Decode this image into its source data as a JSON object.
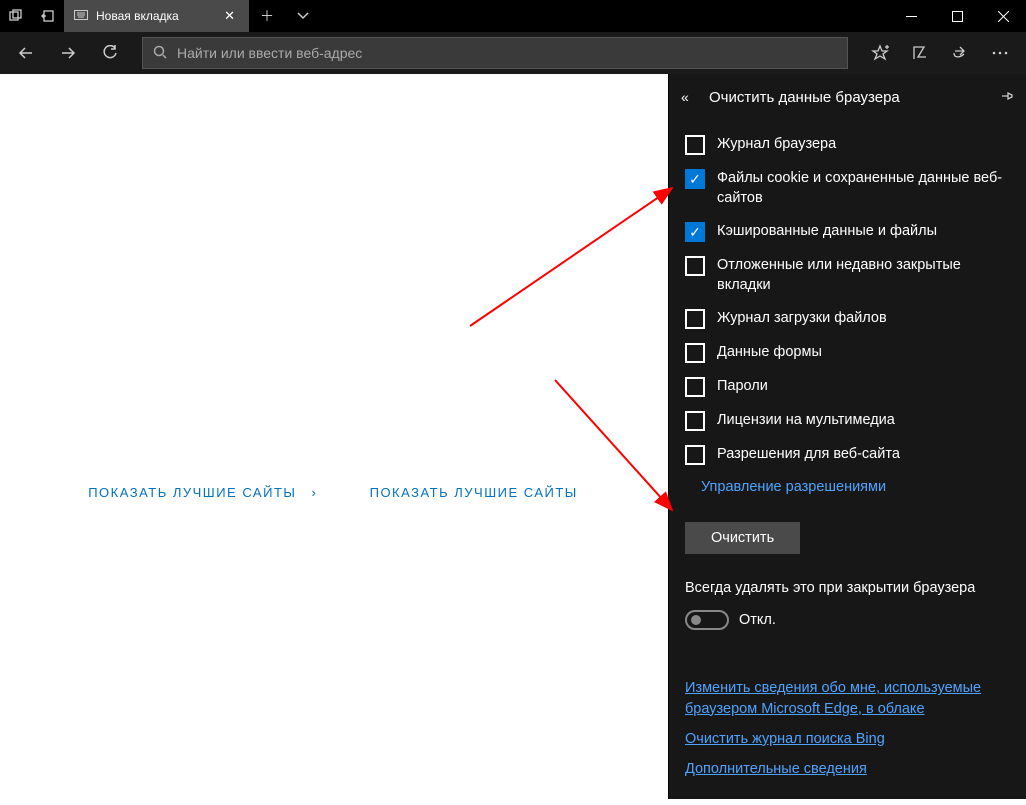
{
  "tab": {
    "title": "Новая вкладка"
  },
  "addressbar": {
    "placeholder": "Найти или ввести веб-адрес"
  },
  "content": {
    "top_sites_label_1": "ПОКАЗАТЬ ЛУЧШИЕ САЙТЫ",
    "top_sites_label_2": "ПОКАЗАТЬ ЛУЧШИЕ САЙТЫ"
  },
  "panel": {
    "title": "Очистить данные браузера",
    "options": [
      {
        "label": "Журнал браузера",
        "checked": false
      },
      {
        "label": "Файлы cookie и сохраненные данные веб-сайтов",
        "checked": true
      },
      {
        "label": "Кэшированные данные и файлы",
        "checked": true
      },
      {
        "label": "Отложенные или недавно закрытые вкладки",
        "checked": false
      },
      {
        "label": "Журнал загрузки файлов",
        "checked": false
      },
      {
        "label": "Данные формы",
        "checked": false
      },
      {
        "label": "Пароли",
        "checked": false
      },
      {
        "label": "Лицензии на мультимедиа",
        "checked": false
      },
      {
        "label": "Разрешения для веб-сайта",
        "checked": false
      }
    ],
    "manage_permissions": "Управление разрешениями",
    "clear_button": "Очистить",
    "always_clear_label": "Всегда удалять это при закрытии браузера",
    "toggle_state": "Откл.",
    "footer_links": {
      "cloud": "Изменить сведения обо мне, используемые браузером Microsoft Edge, в облаке",
      "bing": "Очистить журнал поиска Bing",
      "more": "Дополнительные сведения"
    }
  }
}
